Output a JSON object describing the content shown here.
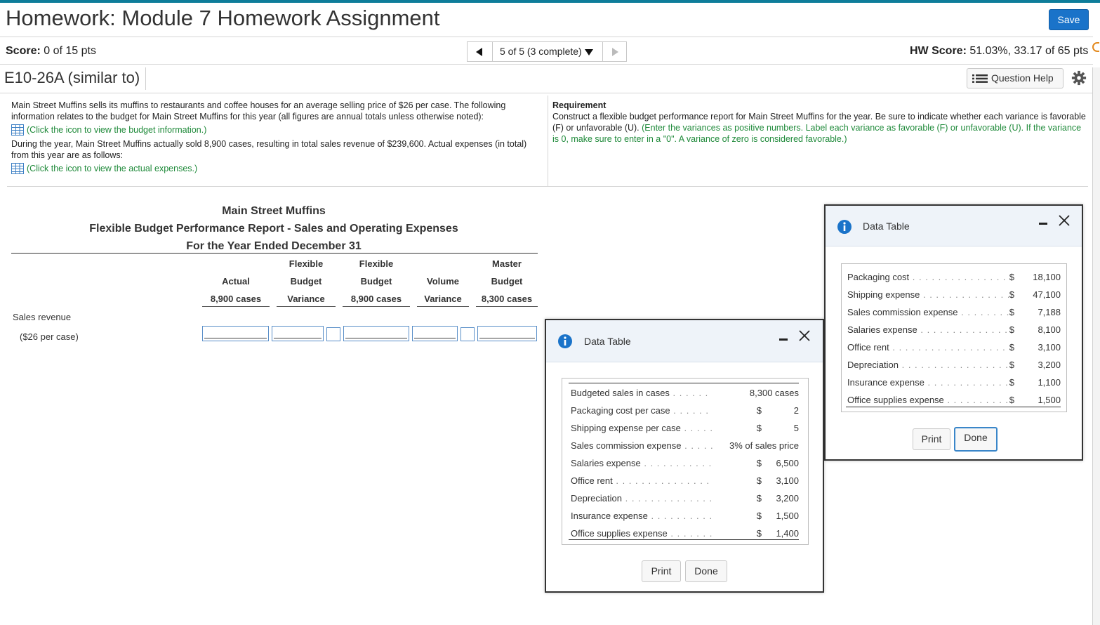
{
  "header": {
    "title": "Homework: Module 7 Homework Assignment",
    "save_label": "Save",
    "score_label": "Score:",
    "score_value": " 0 of 15 pts",
    "pager_text": "5 of 5 (3 complete)",
    "hw_score_label": "HW Score:",
    "hw_score_value": " 51.03%, 33.17 of 65 pts"
  },
  "question": {
    "id": "E10-26A (similar to)",
    "help_label": "Question Help",
    "intro": "Main Street Muffins sells its muffins to restaurants and coffee houses for an average selling price of $26 per case. The following information relates to the budget for Main Street Muffins for this year (all figures are annual totals unless otherwise noted):",
    "budget_link": "(Click the icon to view the budget information.)",
    "actual_text": "During the year, Main Street Muffins actually sold 8,900 cases, resulting in total sales revenue of $239,600. Actual expenses (in total) from this year are as follows:",
    "actual_link": "(Click the icon to view the actual expenses.)",
    "requirement_heading": "Requirement",
    "requirement_text": "Construct a flexible budget performance report for Main Street Muffins for the year. Be sure to indicate whether each variance is favorable (F) or unfavorable (U). ",
    "requirement_green": "(Enter the variances as positive numbers. Label each variance as favorable (F) or unfavorable (U). If the variance is 0, make sure to enter in a \"0\". A variance of zero is considered favorable.)"
  },
  "report": {
    "company": "Main Street Muffins",
    "title": "Flexible Budget Performance Report - Sales and Operating Expenses",
    "period": "For the Year Ended December 31",
    "columns": [
      {
        "l1": "",
        "l2": "Actual",
        "l3": "8,900 cases"
      },
      {
        "l1": "Flexible",
        "l2": "Budget",
        "l3": "Variance"
      },
      {
        "l1": "Flexible",
        "l2": "Budget",
        "l3": "8,900 cases"
      },
      {
        "l1": "",
        "l2": "Volume",
        "l3": "Variance"
      },
      {
        "l1": "Master",
        "l2": "Budget",
        "l3": "8,300 cases"
      }
    ],
    "row_label": "Sales revenue",
    "row_sublabel": "($26 per case)"
  },
  "modal_budget": {
    "title": "Data Table",
    "rows": [
      {
        "label": "Budgeted sales in cases",
        "cur": "",
        "val": "8,300 cases"
      },
      {
        "label": "Packaging cost per case",
        "cur": "$",
        "val": "2"
      },
      {
        "label": "Shipping expense per case",
        "cur": "$",
        "val": "5"
      },
      {
        "label": "Sales commission expense",
        "cur": "",
        "val": "3% of sales price"
      },
      {
        "label": "Salaries expense",
        "cur": "$",
        "val": "6,500"
      },
      {
        "label": "Office rent",
        "cur": "$",
        "val": "3,100"
      },
      {
        "label": "Depreciation",
        "cur": "$",
        "val": "3,200"
      },
      {
        "label": "Insurance expense",
        "cur": "$",
        "val": "1,500"
      },
      {
        "label": "Office supplies expense",
        "cur": "$",
        "val": "1,400"
      }
    ],
    "print_label": "Print",
    "done_label": "Done"
  },
  "modal_actual": {
    "title": "Data Table",
    "rows": [
      {
        "label": "Packaging cost",
        "cur": "$",
        "val": "18,100"
      },
      {
        "label": "Shipping expense",
        "cur": "$",
        "val": "47,100"
      },
      {
        "label": "Sales commission expense",
        "cur": "$",
        "val": "7,188"
      },
      {
        "label": "Salaries expense",
        "cur": "$",
        "val": "8,100"
      },
      {
        "label": "Office rent",
        "cur": "$",
        "val": "3,100"
      },
      {
        "label": "Depreciation",
        "cur": "$",
        "val": "3,200"
      },
      {
        "label": "Insurance expense",
        "cur": "$",
        "val": "1,100"
      },
      {
        "label": "Office supplies expense",
        "cur": "$",
        "val": "1,500"
      }
    ],
    "print_label": "Print",
    "done_label": "Done"
  },
  "colors": {
    "accent": "#1a73c9",
    "topbar": "#0e7d9a",
    "link_green": "#1f8a3a"
  }
}
